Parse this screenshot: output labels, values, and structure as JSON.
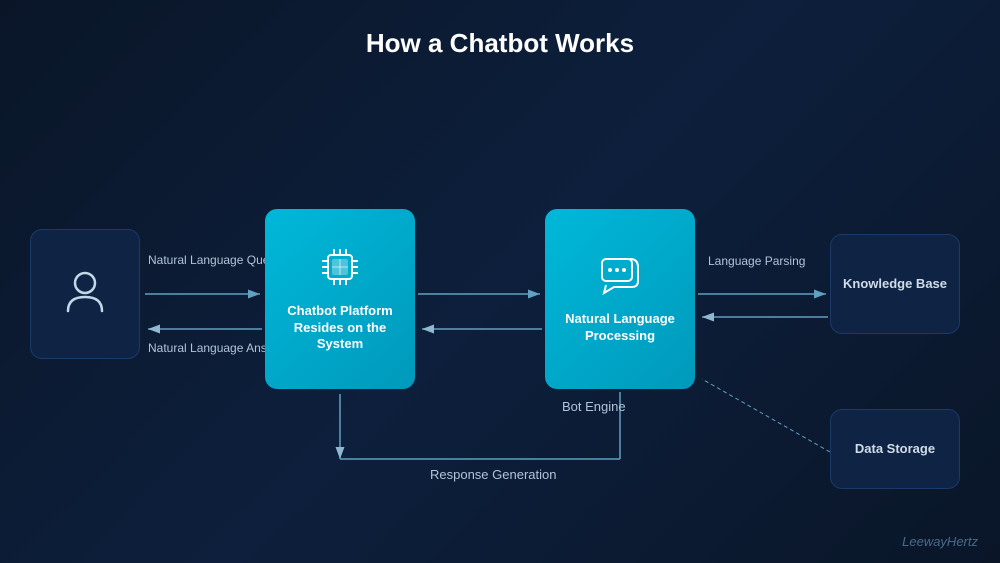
{
  "title": "How a Chatbot Works",
  "boxes": {
    "user": {
      "label": ""
    },
    "chatbot": {
      "label": "Chatbot Platform Resides on the System"
    },
    "nlp": {
      "label": "Natural Language Processing"
    },
    "knowledge_base": {
      "label": "Knowledge Base"
    },
    "data_storage": {
      "label": "Data Storage"
    }
  },
  "arrow_labels": {
    "natural_language_question": "Natural\nLanguage\nQuestion",
    "natural_language_answer": "Natural\nLanguage\nAnswer",
    "language_parsing": "Language\nParsing",
    "bot_engine": "Bot Engine",
    "response_generation": "Response Generation"
  },
  "watermark": "LeewayHertz"
}
